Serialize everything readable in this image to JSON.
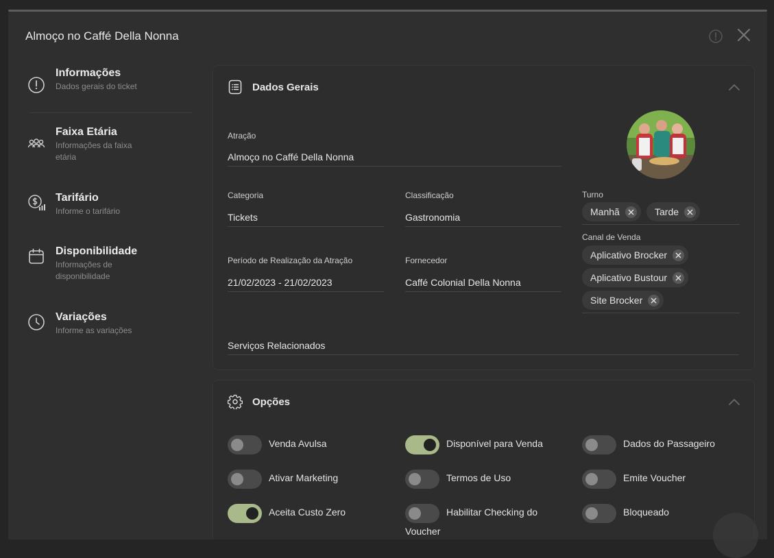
{
  "modal": {
    "title": "Almoço no Caffé Della Nonna",
    "info_icon": "info-circle-icon",
    "close_icon": "close-icon"
  },
  "nav": {
    "items": [
      {
        "title": "Informações",
        "desc": "Dados gerais do ticket",
        "icon": "info-circle-icon"
      },
      {
        "title": "Faixa Etária",
        "desc": "Informações da faixa etária",
        "icon": "users-icon"
      },
      {
        "title": "Tarifário",
        "desc": "Informe o tarifário",
        "icon": "price-chart-icon"
      },
      {
        "title": "Disponibilidade",
        "desc": "Informações de disponibilidade",
        "icon": "calendar-icon"
      },
      {
        "title": "Variações",
        "desc": "Informe as variações",
        "icon": "clock-icon"
      }
    ]
  },
  "general": {
    "title": "Dados Gerais",
    "icon": "document-list-icon",
    "attraction": {
      "label": "Atração",
      "value": "Almoço no Caffé Della Nonna"
    },
    "category": {
      "label": "Categoria",
      "value": "Tickets"
    },
    "classification": {
      "label": "Classificação",
      "value": "Gastronomia"
    },
    "shift": {
      "label": "Turno",
      "chips": [
        "Manhã",
        "Tarde"
      ]
    },
    "period": {
      "label": "Período de Realização da Atração",
      "value": "21/02/2023 - 21/02/2023"
    },
    "supplier": {
      "label": "Fornecedor",
      "value": "Caffé Colonial Della Nonna"
    },
    "sales_channel": {
      "label": "Canal de Venda",
      "chips": [
        "Aplicativo Brocker",
        "Aplicativo Bustour",
        "Site Brocker"
      ]
    },
    "related_services": {
      "label": "Serviços Relacionados"
    }
  },
  "options": {
    "title": "Opções",
    "icon": "gear-icon",
    "toggles": [
      {
        "label": "Venda Avulsa",
        "on": false
      },
      {
        "label": "Disponível para Venda",
        "on": true
      },
      {
        "label": "Dados do Passageiro",
        "on": false
      },
      {
        "label": "Ativar Marketing",
        "on": false
      },
      {
        "label": "Termos de Uso",
        "on": false
      },
      {
        "label": "Emite Voucher",
        "on": false
      },
      {
        "label": "Aceita Custo Zero",
        "on": true
      },
      {
        "label": "Habilitar Checking do Voucher",
        "on": false
      },
      {
        "label": "Bloqueado",
        "on": false
      }
    ]
  },
  "colors": {
    "background": "#252525",
    "panel": "#2f2f2f",
    "toggle_on": "#a9b98a",
    "toggle_off": "#4a4a4a"
  }
}
